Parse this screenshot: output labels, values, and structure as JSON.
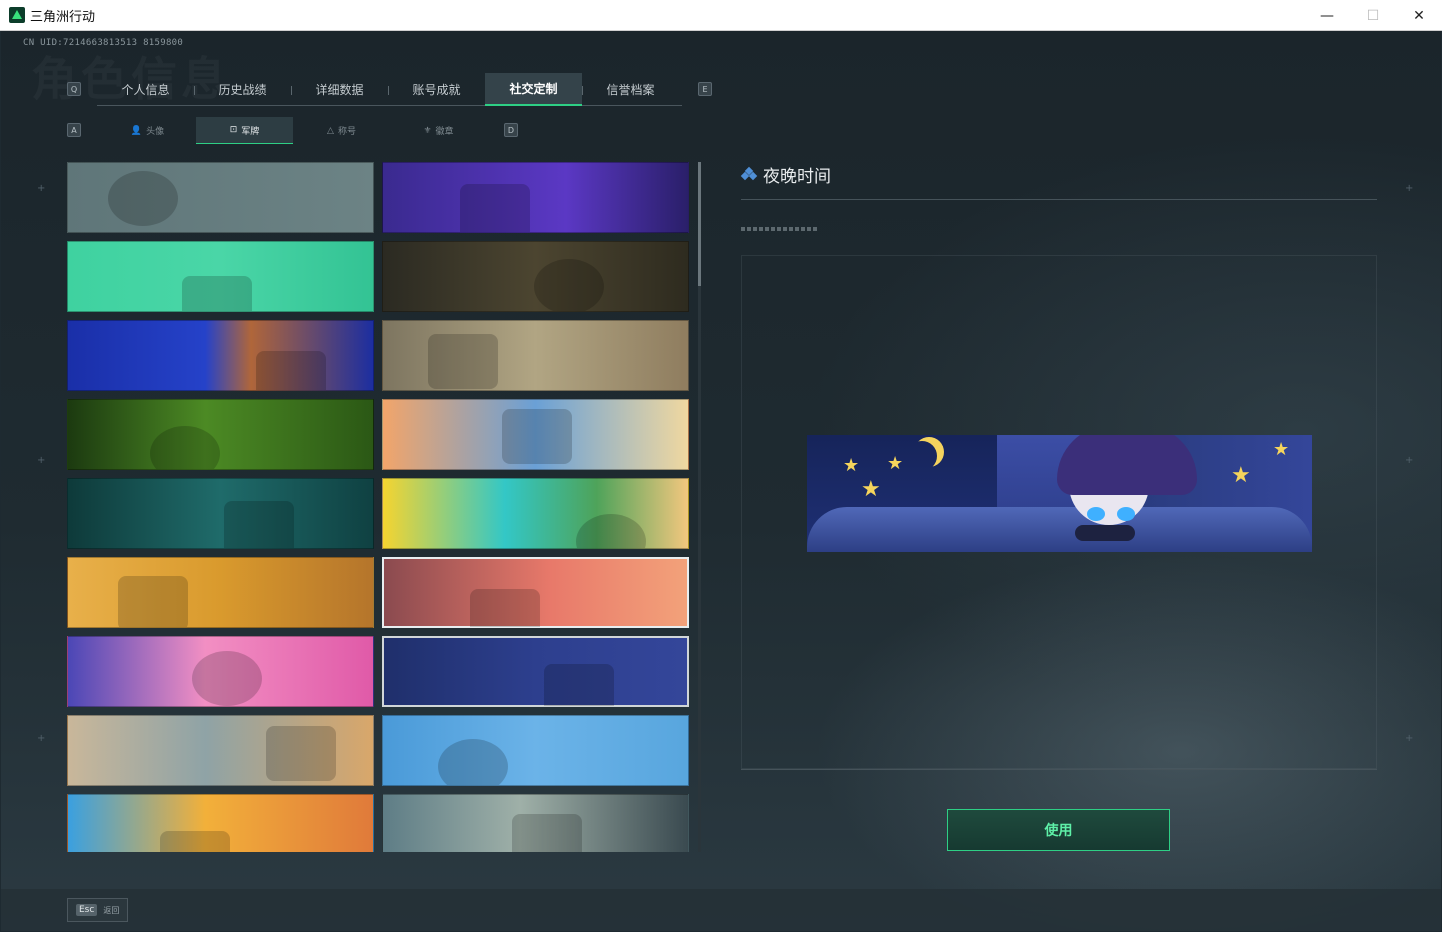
{
  "window": {
    "title": "三角洲行动",
    "controls": {
      "minimize": "—",
      "maximize": "☐",
      "close": "✕"
    }
  },
  "game": {
    "uid": "CN UID:7214663813513 8159800",
    "watermark": "角色信息",
    "tab_key_left": "Q",
    "tab_key_right": "E",
    "main_tabs": [
      {
        "label": "个人信息",
        "active": false
      },
      {
        "label": "历史战绩",
        "active": false
      },
      {
        "label": "详细数据",
        "active": false
      },
      {
        "label": "账号成就",
        "active": false
      },
      {
        "label": "社交定制",
        "active": true
      },
      {
        "label": "信誉档案",
        "active": false
      }
    ],
    "subtab_key_left": "A",
    "subtab_key_right": "D",
    "sub_tabs": [
      {
        "label": "头像",
        "icon": "person-icon",
        "glyph": "👤",
        "active": false
      },
      {
        "label": "军牌",
        "icon": "dogtag-icon",
        "glyph": "⊡",
        "active": true
      },
      {
        "label": "称号",
        "icon": "title-icon",
        "glyph": "△",
        "active": false
      },
      {
        "label": "徽章",
        "icon": "badge-icon",
        "glyph": "⚜",
        "active": false
      }
    ],
    "cards": [
      {
        "name": "card-delta-logo",
        "bg": "linear-gradient(90deg,#5f7679,#6c8385)",
        "selected": false
      },
      {
        "name": "card-purple-device",
        "bg": "linear-gradient(90deg,#3a2a8f,#5b38c4 60%,#2a1f6a)",
        "selected": false
      },
      {
        "name": "card-green-cartoon",
        "bg": "linear-gradient(90deg,#3fd2a0,#4ad6a7 50%,#33c394)",
        "selected": false
      },
      {
        "name": "card-weapons-table",
        "bg": "linear-gradient(90deg,#2b2a22,#4c4530 50%,#2e2b1f)",
        "selected": false
      },
      {
        "name": "card-blue-glitch",
        "bg": "linear-gradient(90deg,#1a2fa8,#2542c9 45%,#b0663a 60%,#1c2ea0)",
        "selected": false
      },
      {
        "name": "card-sniper-desert",
        "bg": "linear-gradient(90deg,#7d7560,#b1a583 50%,#8f7d5f)",
        "selected": false
      },
      {
        "name": "card-night-vision",
        "bg": "linear-gradient(90deg,#1c3a10,#4c8a24 45%,#2b5815)",
        "selected": false
      },
      {
        "name": "card-orange-art",
        "bg": "linear-gradient(90deg,#f2a56a,#6aa0d6 50%,#f0d8a0)",
        "selected": false
      },
      {
        "name": "card-gym",
        "bg": "linear-gradient(90deg,#0e3a3a,#1f6b6a 50%,#0f4142)",
        "selected": false
      },
      {
        "name": "card-music-headphones",
        "bg": "linear-gradient(90deg,#f5d430,#33c7c6 40%,#4ea35a 70%,#f2c77e)",
        "selected": false
      },
      {
        "name": "card-surreal-desert",
        "bg": "linear-gradient(90deg,#e8b04a,#d99a2d 50%,#b5752b)",
        "selected": false
      },
      {
        "name": "card-sunset-girl",
        "bg": "linear-gradient(90deg,#8a4a4f,#e8796a 55%,#f3a27a)",
        "selected": true
      },
      {
        "name": "card-pink-train",
        "bg": "linear-gradient(90deg,#4b47b6,#f28fc3 45%,#e05aa8)",
        "selected": false
      },
      {
        "name": "card-night-time",
        "bg": "linear-gradient(90deg,#1f2f6b,#2d3f8e 50%,#34469a)",
        "selected": false,
        "highlight": true
      },
      {
        "name": "card-beach",
        "bg": "linear-gradient(90deg,#c9b79a,#8fa3a6 45%,#d9a76a)",
        "selected": false
      },
      {
        "name": "card-shiba-squad",
        "bg": "linear-gradient(90deg,#4a9ad8,#6bb3e8 50%,#58a6de)",
        "selected": false
      },
      {
        "name": "card-market",
        "bg": "linear-gradient(90deg,#3aa0e0,#f2b03a 45%,#e07a3a)",
        "selected": false
      },
      {
        "name": "card-mechanic",
        "bg": "linear-gradient(90deg,#5e7d86,#9fb0a8 45%,#3a4a50)",
        "selected": false
      }
    ],
    "detail": {
      "title": "夜晚时间",
      "icon": "diamond-icon"
    },
    "use_button": "使用",
    "esc_key": "Esc",
    "esc_label": "返回"
  }
}
